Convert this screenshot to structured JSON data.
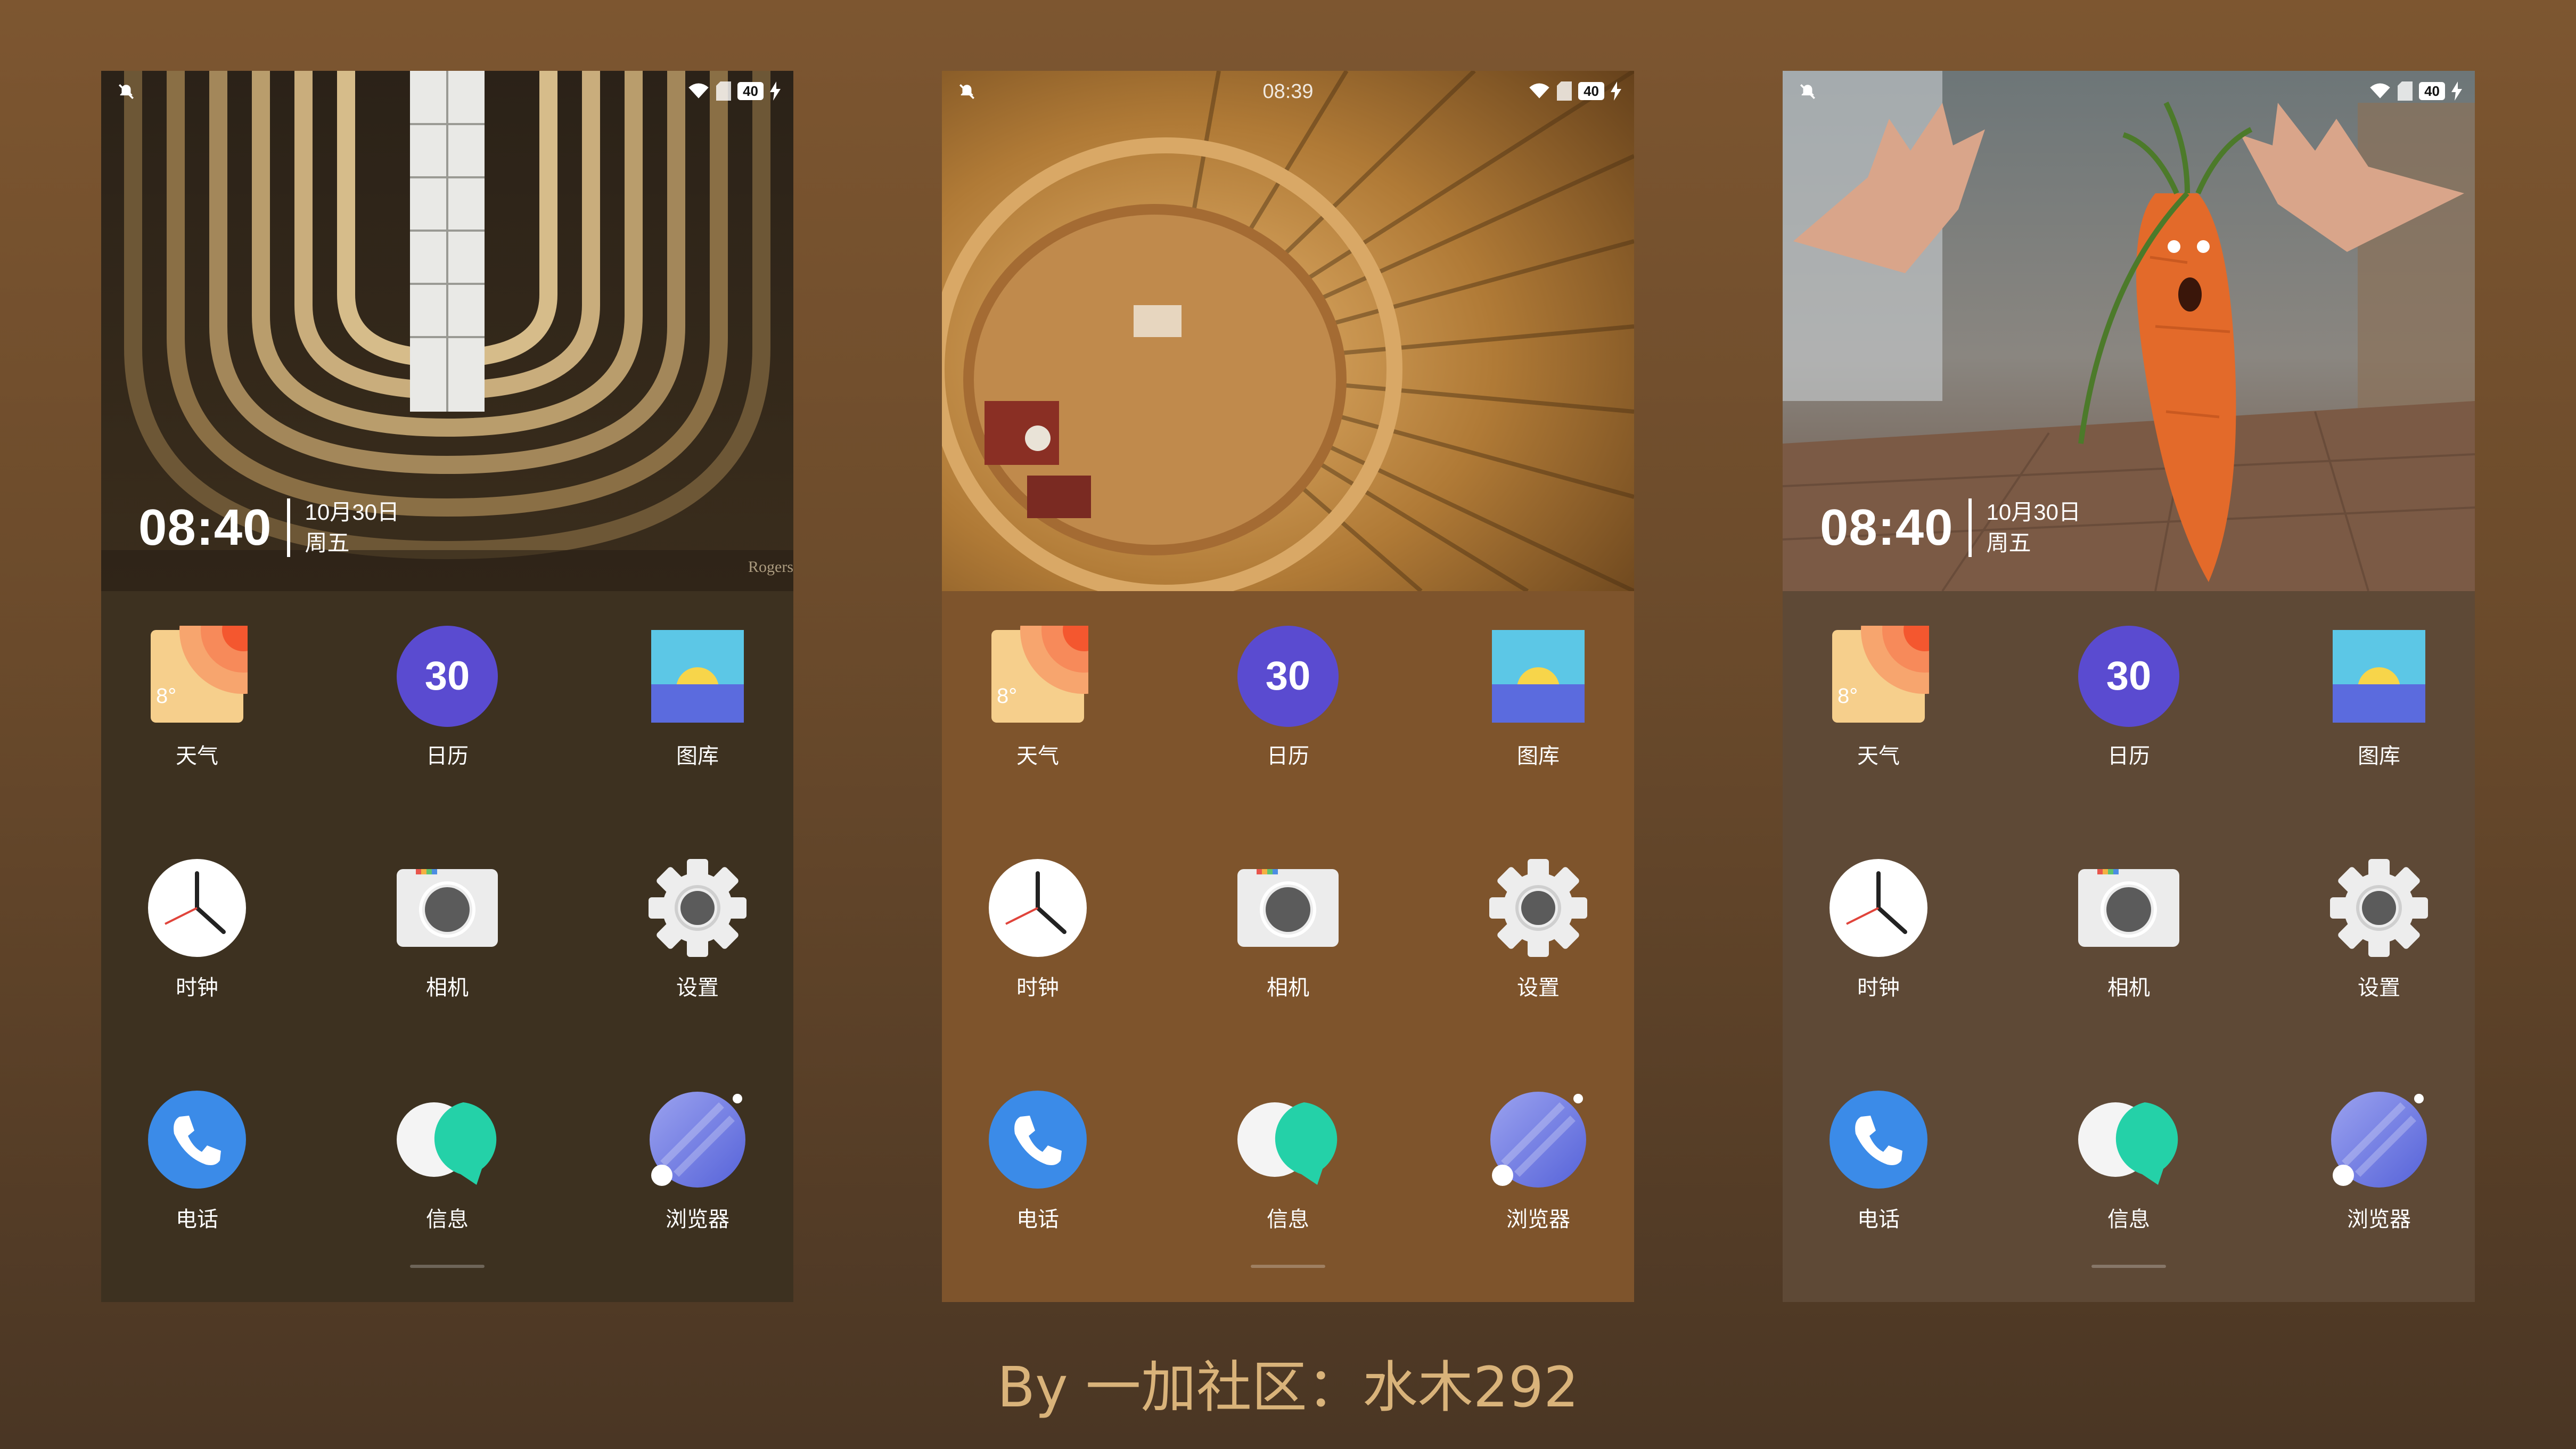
{
  "screens": [
    {
      "id": "left",
      "drawer_color": "#3d3120",
      "status_time": "",
      "clock": {
        "time": "08:40",
        "date": "10月30日",
        "weekday": "周五"
      },
      "watermark": "Rogers"
    },
    {
      "id": "middle",
      "drawer_color": "#7e542c",
      "status_time": "08:39",
      "clock": null
    },
    {
      "id": "right",
      "drawer_color": "#5e4936",
      "status_time": "",
      "clock": {
        "time": "08:40",
        "date": "10月30日",
        "weekday": "周五"
      }
    }
  ],
  "battery": "40",
  "apps": [
    {
      "name": "weather",
      "label": "天气",
      "icon": "weather-icon",
      "badge": "8°"
    },
    {
      "name": "calendar",
      "label": "日历",
      "icon": "calendar-icon",
      "badge": "30"
    },
    {
      "name": "gallery",
      "label": "图库",
      "icon": "gallery-icon"
    },
    {
      "name": "clock",
      "label": "时钟",
      "icon": "clock-icon"
    },
    {
      "name": "camera",
      "label": "相机",
      "icon": "camera-icon"
    },
    {
      "name": "settings",
      "label": "设置",
      "icon": "gear-icon"
    },
    {
      "name": "phone",
      "label": "电话",
      "icon": "phone-icon"
    },
    {
      "name": "messages",
      "label": "信息",
      "icon": "message-icon"
    },
    {
      "name": "browser",
      "label": "浏览器",
      "icon": "browser-icon"
    }
  ],
  "caption": "By 一加社区：水木292"
}
